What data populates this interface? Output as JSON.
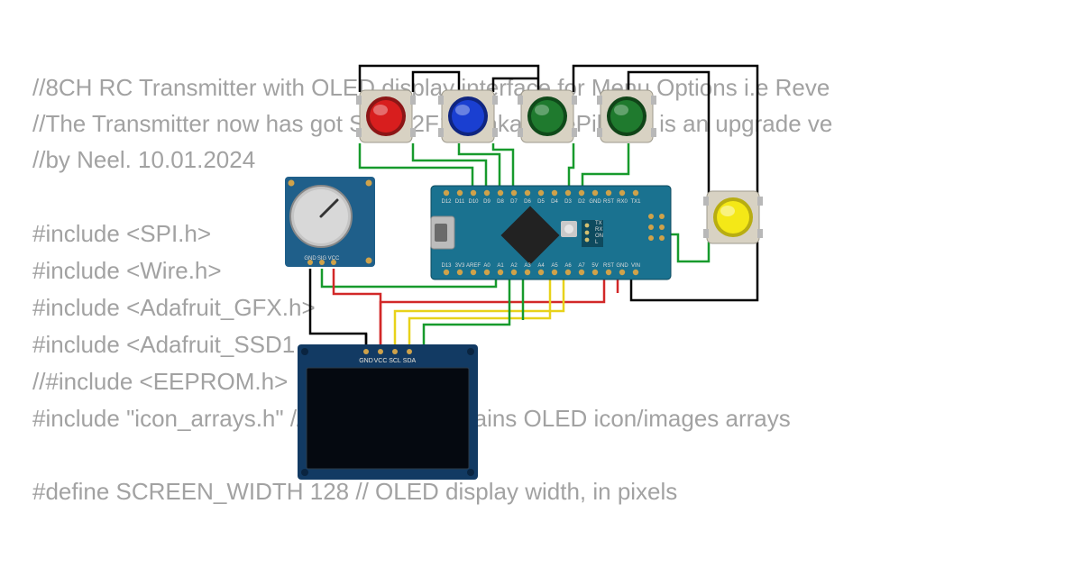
{
  "code_lines": {
    "l1": "//8CH RC Transmitter with OLED display interface for Menu Options i.e Reve",
    "l2": "//The Transmitter now has got STM32F103 aka BluePill and is an upgrade ve",
    "l3": "//by Neel. 10.01.2024",
    "l4": "#include <SPI.h>",
    "l5": "#include <Wire.h>",
    "l6": "#include <Adafruit_GFX.h>",
    "l7": "#include <Adafruit_SSD1",
    "l8": "//#include <EEPROM.h>",
    "l9": "#include \"icon_arrays.h\" // Header file contains OLED icon/images arrays",
    "l10": "#define SCREEN_WIDTH 128 // OLED display width, in pixels"
  },
  "components": {
    "potentiometer": {
      "pins": {
        "gnd": "GND",
        "sig": "SIG",
        "vcc": "VCC"
      }
    },
    "oled": {
      "pins": {
        "gnd": "GND",
        "vcc": "VCC",
        "scl": "SCL",
        "sda": "SDA"
      }
    },
    "arduino_nano": {
      "top_pins": [
        "D12",
        "D11",
        "D10",
        "D9",
        "D8",
        "D7",
        "D6",
        "D5",
        "D4",
        "D3",
        "D2",
        "GND",
        "RST",
        "RX0",
        "TX1"
      ],
      "bottom_pins": [
        "D13",
        "3V3",
        "AREF",
        "A0",
        "A1",
        "A2",
        "A3",
        "A4",
        "A5",
        "A6",
        "A7",
        "5V",
        "RST",
        "GND",
        "VIN"
      ],
      "side_text": [
        "TX",
        "RX",
        "ON",
        "L"
      ]
    },
    "buttons": {
      "red": {
        "color": "#d81e1e"
      },
      "blue": {
        "color": "#1a3fd1"
      },
      "green": {
        "color": "#1f7a2e"
      },
      "yellow": {
        "color": "#f4e817"
      }
    }
  },
  "wires": {
    "colors": {
      "black": "#000000",
      "red": "#d22828",
      "green": "#179a2c",
      "yellow": "#e8d21a"
    }
  }
}
